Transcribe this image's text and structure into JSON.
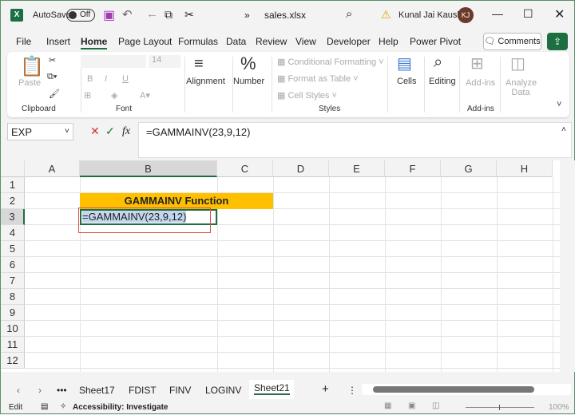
{
  "titlebar": {
    "autosave": "AutoSave",
    "toggle": "Off",
    "filename": "sales.xlsx",
    "user": "Kunal Jai Kaushik",
    "initials": "KJ",
    "overflow": "»"
  },
  "menu": {
    "tabs": [
      "File",
      "Insert",
      "Home",
      "Page Layout",
      "Formulas",
      "Data",
      "Review",
      "View",
      "Developer",
      "Help",
      "Power Pivot"
    ],
    "active": "Home",
    "comments": "Comments"
  },
  "ribbon": {
    "paste": "Paste",
    "clipboard": "Clipboard",
    "font_size": "14",
    "font": "Font",
    "alignment": "Alignment",
    "number": "Number",
    "cond_fmt": "Conditional Formatting",
    "fmt_table": "Format as Table",
    "cell_styles": "Cell Styles",
    "styles": "Styles",
    "cells": "Cells",
    "editing": "Editing",
    "addins": "Add-ins",
    "analyze": "Analyze Data",
    "addins_group": "Add-ins",
    "bold": "B",
    "italic": "I",
    "underline": "U"
  },
  "formula_bar": {
    "name_box": "EXP",
    "fx": "fx",
    "formula": "=GAMMAINV(23,9,12)"
  },
  "grid": {
    "columns": [
      "A",
      "B",
      "C",
      "D",
      "E",
      "F",
      "G",
      "H"
    ],
    "rows": [
      "1",
      "2",
      "3",
      "4",
      "5",
      "6",
      "7",
      "8",
      "9",
      "10",
      "11",
      "12"
    ],
    "b2": "GAMMAINV Function",
    "b3": "=GAMMAINV(23,9,12)"
  },
  "sheets": {
    "tabs": [
      "Sheet17",
      "FDIST",
      "FINV",
      "LOGINV",
      "Sheet21"
    ],
    "active": "Sheet21"
  },
  "statusbar": {
    "mode": "Edit",
    "accessibility": "Accessibility: Investigate",
    "zoom": "100%"
  },
  "colors": {
    "excel_green": "#1d6f42",
    "header_fill": "#ffc000",
    "selection": "#c5d7ef",
    "highlight_border": "#d9534f"
  }
}
